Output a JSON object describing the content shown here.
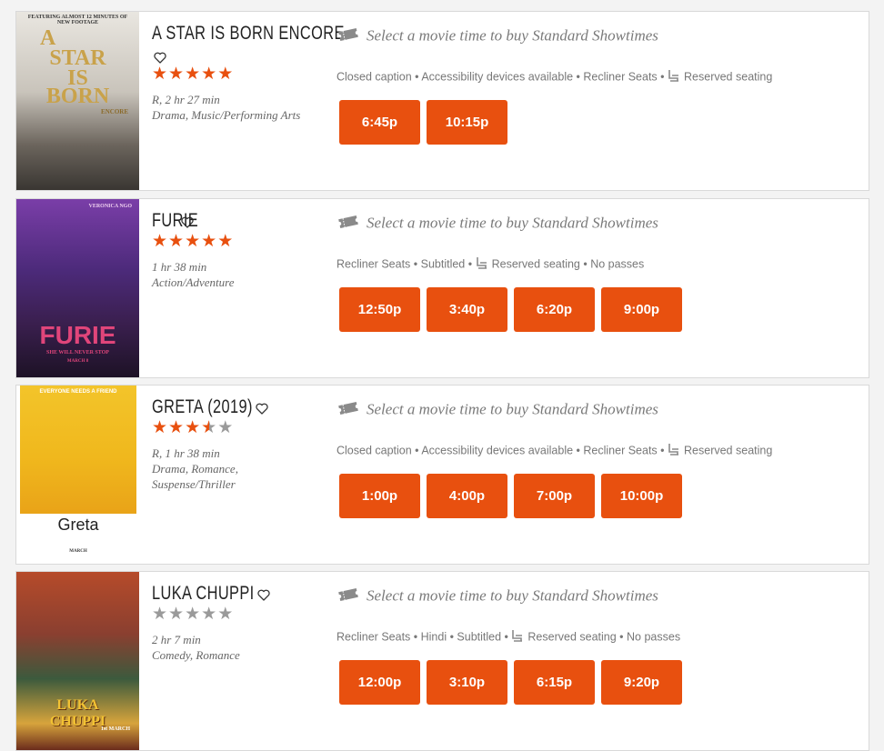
{
  "colors": {
    "accent": "#e8500f",
    "star_filled": "#e8500f",
    "star_empty": "#9a9a9a"
  },
  "movies": [
    {
      "title": "A STAR IS BORN ENCORE",
      "poster_text": [
        "FEATURING ALMOST 12 MINUTES OF NEW FOOTAGE",
        "A",
        "STAR",
        "IS",
        "BORN",
        "ENCORE"
      ],
      "rating_stars": 5,
      "meta_line1": "R, 2 hr 27 min",
      "meta_line2": "Drama, Music/Performing Arts",
      "showtimes_heading": "Select a movie time to buy Standard Showtimes",
      "amenities_before": "Closed caption • Accessibility devices available • Recliner Seats •",
      "amenities_after": "Reserved seating",
      "times": [
        "6:45p",
        "10:15p"
      ]
    },
    {
      "title": "FURIE",
      "poster_text": [
        "VERONICA NGO",
        "FURIE",
        "SHE WILL NEVER STOP",
        "MARCH 8"
      ],
      "rating_stars": 5,
      "meta_line1": "1 hr 38 min",
      "meta_line2": "Action/Adventure",
      "showtimes_heading": "Select a movie time to buy Standard Showtimes",
      "amenities_before": "Recliner Seats • Subtitled •",
      "amenities_after": "Reserved seating • No passes",
      "times": [
        "12:50p",
        "3:40p",
        "6:20p",
        "9:00p"
      ]
    },
    {
      "title": "GRETA (2019)",
      "poster_text": [
        "EVERYONE NEEDS A FRIEND",
        "Greta",
        "MARCH"
      ],
      "rating_stars": 3.5,
      "meta_line1": "R, 1 hr 38 min",
      "meta_line2": "Drama, Romance, Suspense/Thriller",
      "showtimes_heading": "Select a movie time to buy Standard Showtimes",
      "amenities_before": "Closed caption • Accessibility devices available • Recliner Seats •",
      "amenities_after": "Reserved seating",
      "times": [
        "1:00p",
        "4:00p",
        "7:00p",
        "10:00p"
      ]
    },
    {
      "title": "LUKA CHUPPI",
      "poster_text": [
        "LUKA",
        "CHUPPI",
        "1st MARCH"
      ],
      "rating_stars": 0,
      "meta_line1": "2 hr 7 min",
      "meta_line2": "Comedy, Romance",
      "showtimes_heading": "Select a movie time to buy Standard Showtimes",
      "amenities_before": "Recliner Seats • Hindi • Subtitled •",
      "amenities_after": "Reserved seating • No passes",
      "times": [
        "12:00p",
        "3:10p",
        "6:15p",
        "9:20p"
      ]
    }
  ]
}
